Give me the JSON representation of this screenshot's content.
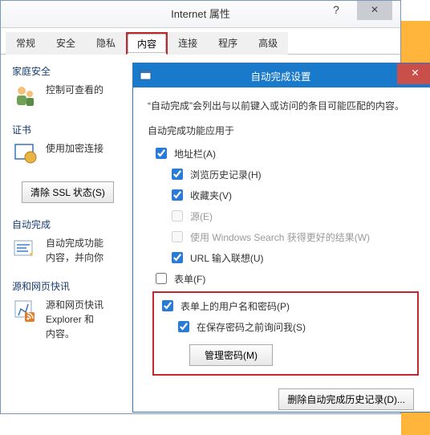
{
  "iprops": {
    "title": "Internet 属性",
    "help": "?",
    "close": "✕",
    "tabs": {
      "general": "常规",
      "security": "安全",
      "privacy": "隐私",
      "content": "内容",
      "connections": "连接",
      "programs": "程序",
      "advanced": "高级"
    },
    "sections": {
      "family": {
        "label": "家庭安全",
        "desc": "控制可查看的"
      },
      "cert": {
        "label": "证书",
        "desc": "使用加密连接",
        "clear_ssl": "清除 SSL 状态(S)"
      },
      "autocomplete": {
        "label": "自动完成",
        "desc": "自动完成功能\n内容，并向你"
      },
      "feeds": {
        "label": "源和网页快讯",
        "desc": "源和网页快讯\nExplorer 和\n内容。"
      }
    }
  },
  "auto": {
    "title": "自动完成设置",
    "close": "✕",
    "desc": "“自动完成”会列出与以前键入或访问的条目可能匹配的内容。",
    "group": "自动完成功能应用于",
    "items": {
      "addr": "地址栏(A)",
      "hist": "浏览历史记录(H)",
      "fav": "收藏夹(V)",
      "src": "源(E)",
      "winsrch": "使用 Windows Search 获得更好的结果(W)",
      "url": "URL 输入联想(U)",
      "forms": "表单(F)",
      "formpw": "表单上的用户名和密码(P)",
      "askpw": "在保存密码之前询问我(S)",
      "manage": "管理密码(M)"
    },
    "delete": "删除自动完成历史记录(D)..."
  }
}
